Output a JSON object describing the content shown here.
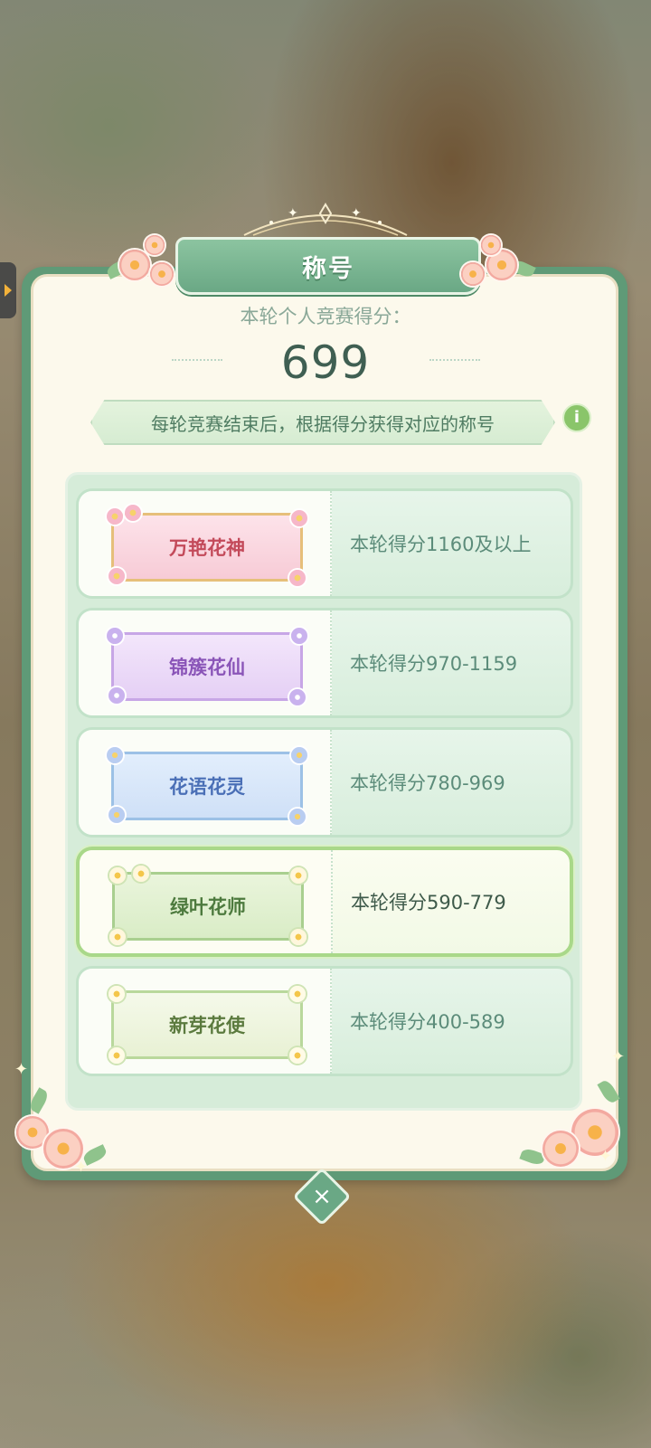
{
  "title": "称号",
  "score": {
    "label": "本轮个人竞赛得分：",
    "value": "699"
  },
  "hint": {
    "text": "每轮竞赛结束后，根据得分获得对应的称号",
    "info_icon": "i"
  },
  "tiers": [
    {
      "name": "万艳花神",
      "requirement": "本轮得分1160及以上",
      "selected": false
    },
    {
      "name": "锦簇花仙",
      "requirement": "本轮得分970-1159",
      "selected": false
    },
    {
      "name": "花语花灵",
      "requirement": "本轮得分780-969",
      "selected": false
    },
    {
      "name": "绿叶花师",
      "requirement": "本轮得分590-779",
      "selected": true
    },
    {
      "name": "新芽花使",
      "requirement": "本轮得分400-589",
      "selected": false
    }
  ],
  "close_icon": "×",
  "colors": {
    "panel_green": "#5f9a77",
    "panel_cream": "#fcf9ec",
    "title_green": "#6aa885",
    "score_text": "#3f5f52"
  },
  "icons": [
    "info-icon",
    "close-icon",
    "side-arrow-icon"
  ]
}
